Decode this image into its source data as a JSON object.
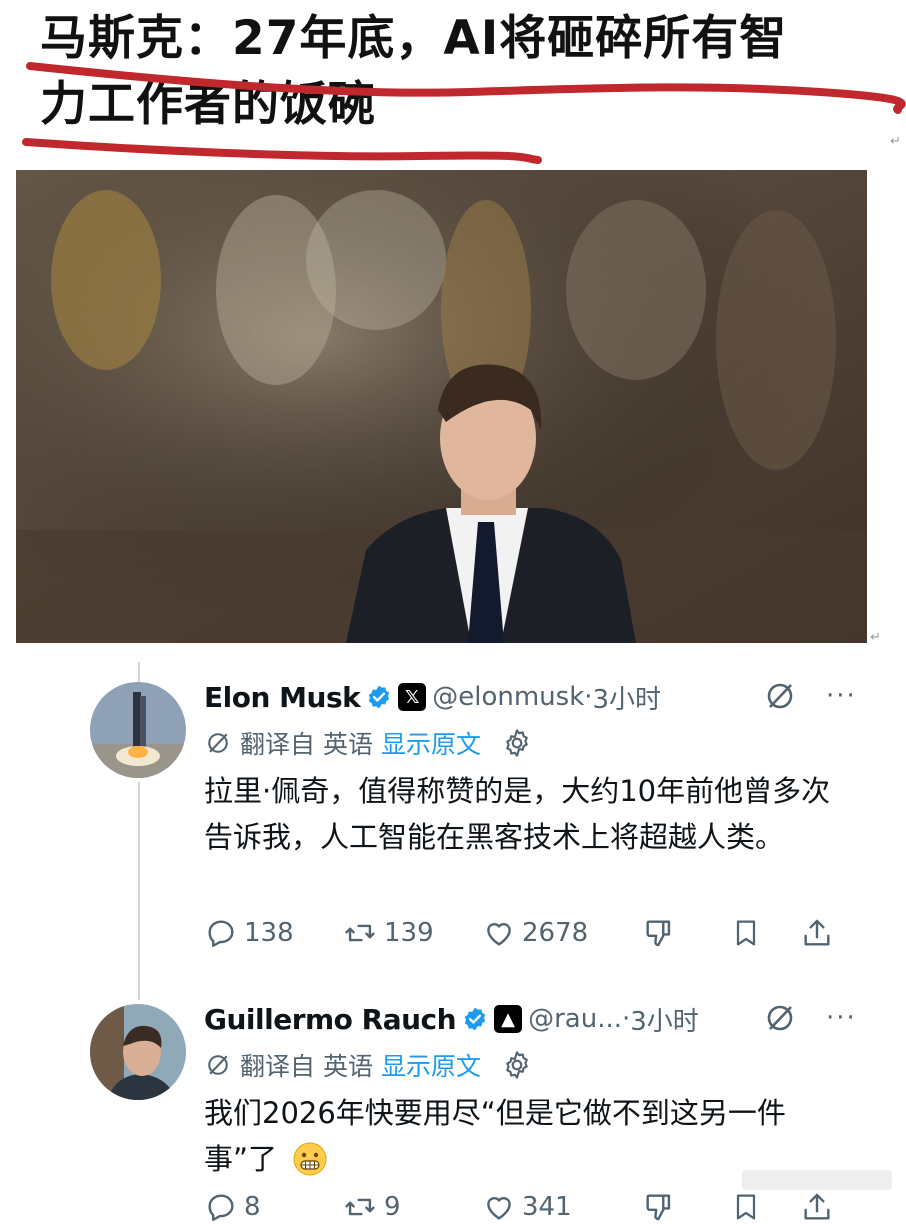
{
  "headline": {
    "line1": "马斯克：27年底，AI将砸碎所有智",
    "line2": "力工作者的饭碗",
    "underline_color": "#c0282e"
  },
  "tweets": [
    {
      "name": "Elon Musk",
      "handle": "@elonmusk",
      "dot": "·",
      "time": "3小时",
      "translate_label": "翻译自 英语",
      "show_original": "显示原文",
      "text": "拉里·佩奇，值得称赞的是，大约10年前他曾多次告诉我，人工智能在黑客技术上将超越人类。",
      "replies": "138",
      "retweets": "139",
      "likes": "2678"
    },
    {
      "name": "Guillermo Rauch",
      "handle": "@rau...",
      "dot": "·",
      "time": "3小时",
      "translate_label": "翻译自 英语",
      "show_original": "显示原文",
      "text": "我们2026年快要用尽“但是它做不到这另一件事”了",
      "replies": "8",
      "retweets": "9",
      "likes": "341"
    }
  ],
  "colors": {
    "verified": "#1d9bf0",
    "link": "#1d9bf0",
    "muted": "#536471",
    "thread_line": "#cfd9de"
  },
  "icons": [
    "reply-icon",
    "retweet-icon",
    "like-icon",
    "dislike-icon",
    "bookmark-icon",
    "share-icon",
    "grok-icon",
    "gear-icon",
    "verified-icon",
    "x-logo-icon",
    "more-icon"
  ]
}
